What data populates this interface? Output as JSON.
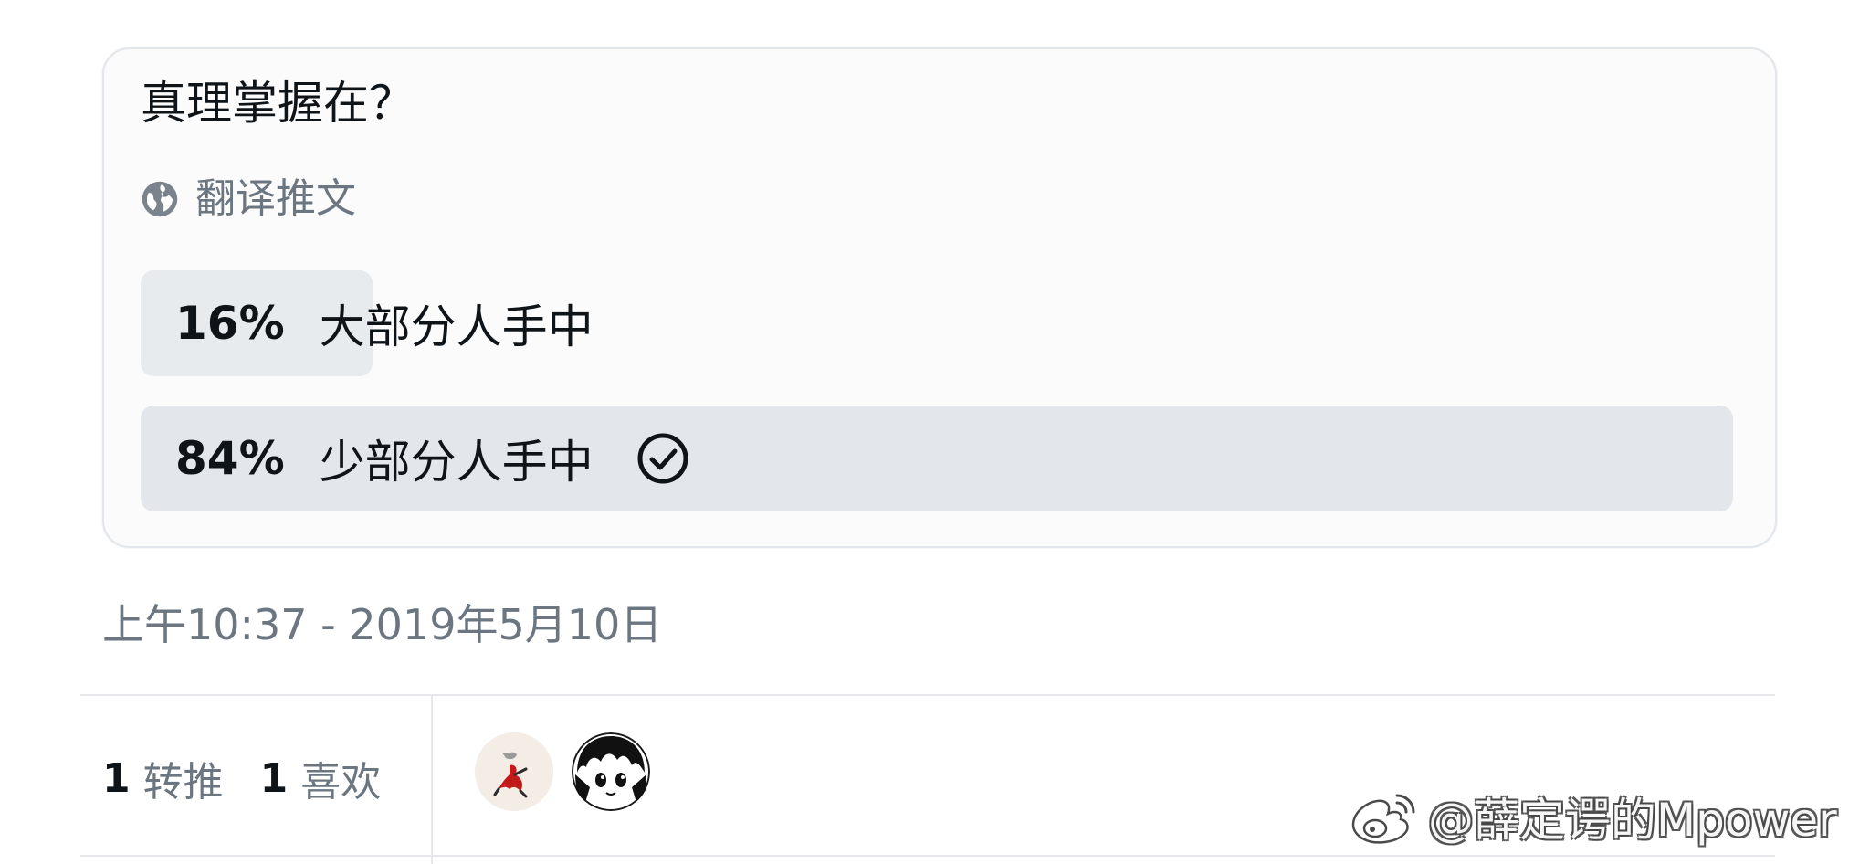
{
  "poll": {
    "question": "真理掌握在？",
    "translate_label": "翻译推文",
    "options": [
      {
        "percent_label": "16%",
        "percent": 16,
        "label": "大部分人手中",
        "selected": false
      },
      {
        "percent_label": "84%",
        "percent": 84,
        "label": "少部分人手中",
        "selected": true
      }
    ]
  },
  "timestamp": "上午10:37 - 2019年5月10日",
  "stats": {
    "retweets_count": "1",
    "retweets_label": "转推",
    "likes_count": "1",
    "likes_label": "喜欢"
  },
  "watermark": {
    "text": "@薛定谔的Mpower"
  },
  "colors": {
    "text_primary": "#0f1419",
    "text_secondary": "#6b7681",
    "poll_bar": "#e3e6ea",
    "border": "#e3e6ea"
  },
  "icons": {
    "translate": "globe-icon",
    "selected_option": "check-circle-icon",
    "watermark_logo": "weibo-logo-icon"
  }
}
